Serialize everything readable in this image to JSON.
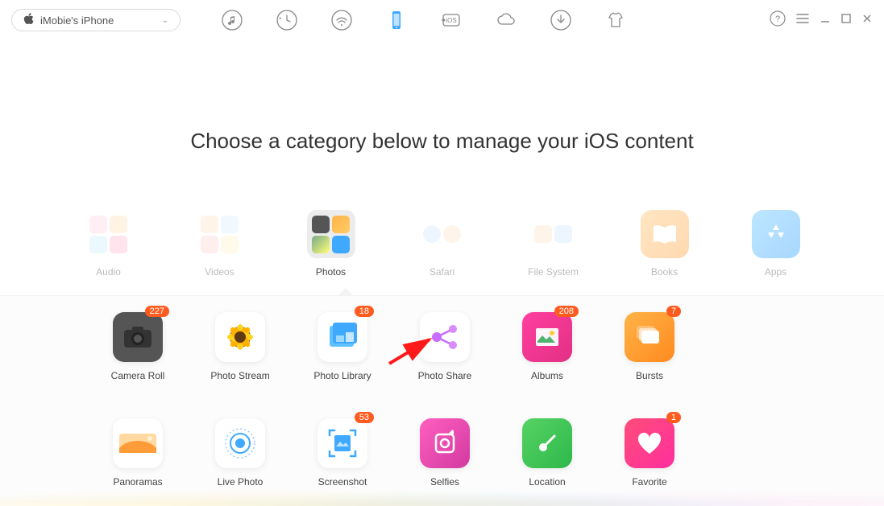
{
  "device": {
    "name": "iMobie's iPhone"
  },
  "heading": "Choose a category below to manage your iOS content",
  "categories": [
    {
      "id": "audio",
      "label": "Audio"
    },
    {
      "id": "videos",
      "label": "Videos"
    },
    {
      "id": "photos",
      "label": "Photos"
    },
    {
      "id": "safari",
      "label": "Safari"
    },
    {
      "id": "filesystem",
      "label": "File System"
    },
    {
      "id": "books",
      "label": "Books"
    },
    {
      "id": "apps",
      "label": "Apps"
    }
  ],
  "selected_category": "photos",
  "sub_items": [
    {
      "id": "camera-roll",
      "label": "Camera Roll",
      "badge": "227"
    },
    {
      "id": "photo-stream",
      "label": "Photo Stream",
      "badge": null
    },
    {
      "id": "photo-library",
      "label": "Photo Library",
      "badge": "18"
    },
    {
      "id": "photo-share",
      "label": "Photo Share",
      "badge": null
    },
    {
      "id": "albums",
      "label": "Albums",
      "badge": "208"
    },
    {
      "id": "bursts",
      "label": "Bursts",
      "badge": "7"
    },
    {
      "id": "panoramas",
      "label": "Panoramas",
      "badge": null
    },
    {
      "id": "live-photo",
      "label": "Live Photo",
      "badge": null
    },
    {
      "id": "screenshot",
      "label": "Screenshot",
      "badge": "53"
    },
    {
      "id": "selfies",
      "label": "Selfies",
      "badge": null
    },
    {
      "id": "location",
      "label": "Location",
      "badge": null
    },
    {
      "id": "favorite",
      "label": "Favorite",
      "badge": "1"
    }
  ]
}
